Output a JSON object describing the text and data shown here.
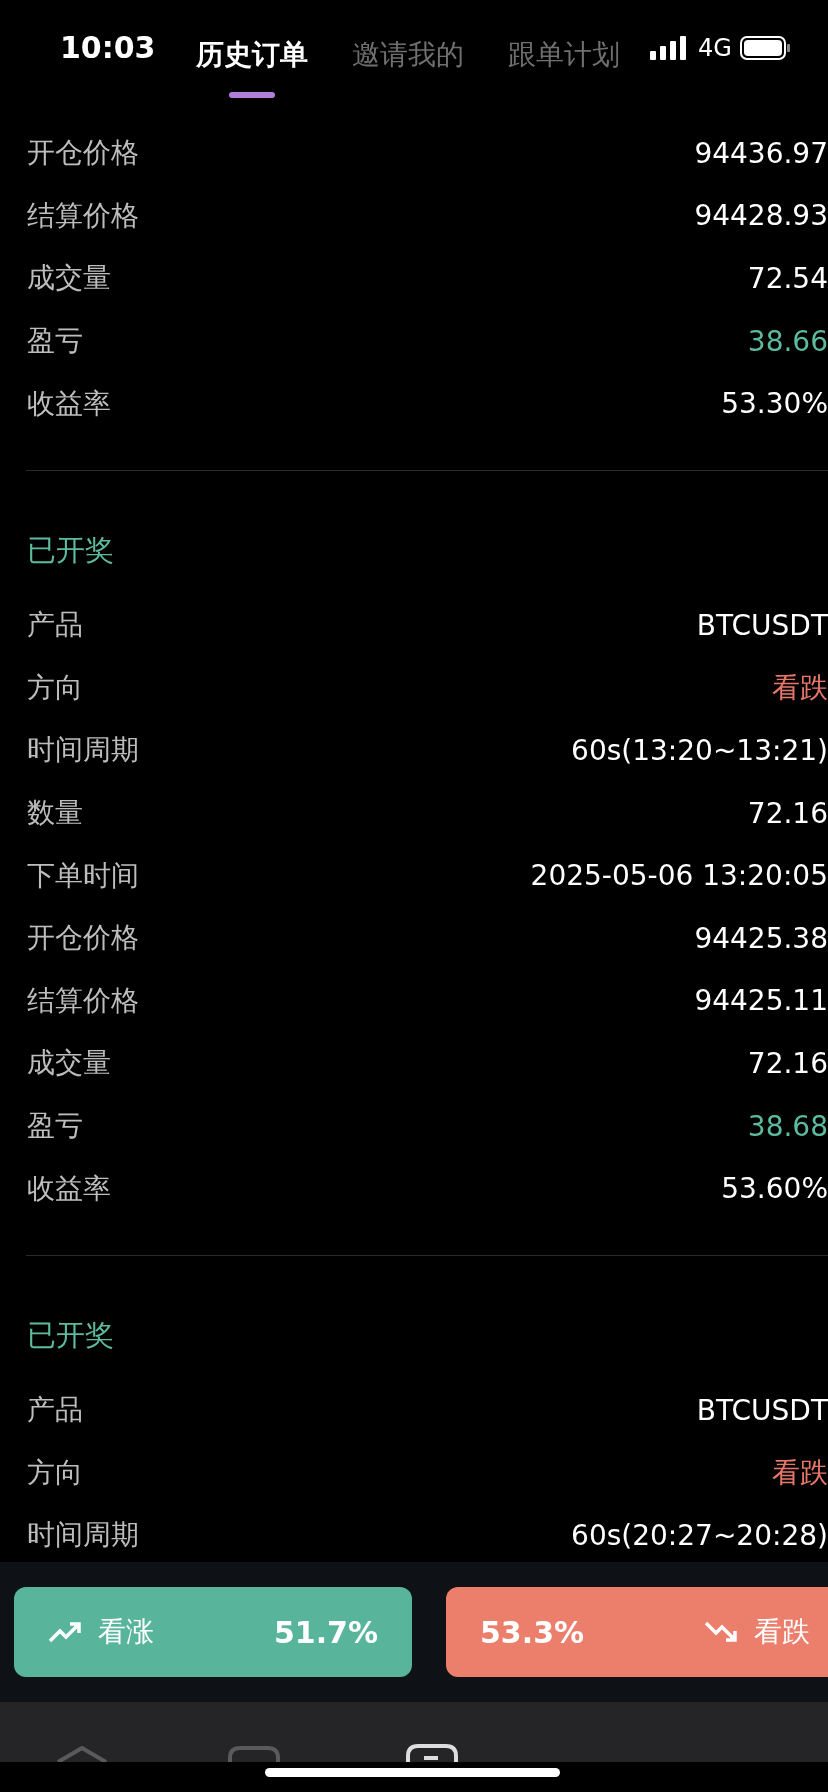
{
  "status_bar": {
    "time": "10:03",
    "network": "4G"
  },
  "tabs": [
    {
      "label": "历史订单",
      "selected": true
    },
    {
      "label": "邀请我的",
      "selected": false
    },
    {
      "label": "跟单计划",
      "selected": false
    }
  ],
  "orders": [
    {
      "fields": [
        {
          "label": "开仓价格",
          "value": "94436.97",
          "color": "#ffffff"
        },
        {
          "label": "结算价格",
          "value": "94428.93",
          "color": "#ffffff"
        },
        {
          "label": "成交量",
          "value": "72.54",
          "color": "#ffffff"
        },
        {
          "label": "盈亏",
          "value": "38.66",
          "color": "#5cbb9e"
        },
        {
          "label": "收益率",
          "value": "53.30%",
          "color": "#ffffff"
        }
      ]
    },
    {
      "status": "已开奖",
      "fields": [
        {
          "label": "产品",
          "value": "BTCUSDT",
          "color": "#ffffff"
        },
        {
          "label": "方向",
          "value": "看跌",
          "color": "#e8776a"
        },
        {
          "label": "时间周期",
          "value": "60s(13:20~13:21)",
          "color": "#ffffff"
        },
        {
          "label": "数量",
          "value": "72.16",
          "color": "#ffffff"
        },
        {
          "label": "下单时间",
          "value": "2025-05-06 13:20:05",
          "color": "#ffffff"
        },
        {
          "label": "开仓价格",
          "value": "94425.38",
          "color": "#ffffff"
        },
        {
          "label": "结算价格",
          "value": "94425.11",
          "color": "#ffffff"
        },
        {
          "label": "成交量",
          "value": "72.16",
          "color": "#ffffff"
        },
        {
          "label": "盈亏",
          "value": "38.68",
          "color": "#5cbb9e"
        },
        {
          "label": "收益率",
          "value": "53.60%",
          "color": "#ffffff"
        }
      ]
    },
    {
      "status": "已开奖",
      "fields": [
        {
          "label": "产品",
          "value": "BTCUSDT",
          "color": "#ffffff"
        },
        {
          "label": "方向",
          "value": "看跌",
          "color": "#e8776a"
        },
        {
          "label": "时间周期",
          "value": "60s(20:27~20:28)",
          "color": "#ffffff"
        }
      ]
    }
  ],
  "actions": [
    {
      "kind": "up",
      "label": "看涨",
      "percent": "51.7%"
    },
    {
      "kind": "down",
      "label": "看跌",
      "percent": "53.3%"
    }
  ]
}
